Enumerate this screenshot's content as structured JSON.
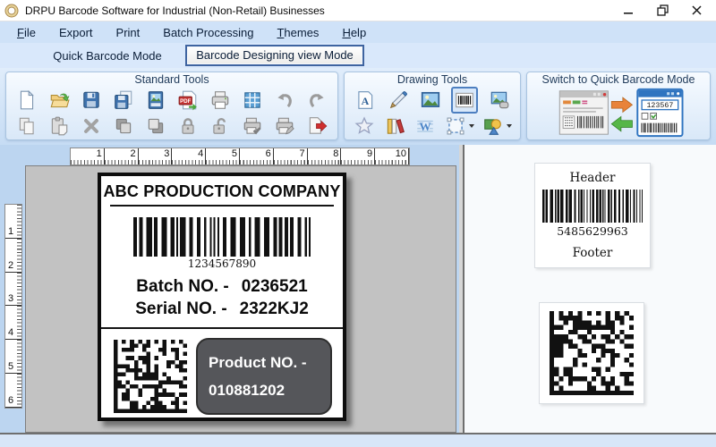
{
  "window": {
    "title": "DRPU Barcode Software for Industrial (Non-Retail) Businesses",
    "controls": [
      "minimize",
      "restore",
      "close"
    ]
  },
  "menu": {
    "items": [
      {
        "label": "File",
        "underline": 0
      },
      {
        "label": "Export",
        "underline": -1
      },
      {
        "label": "Print",
        "underline": -1
      },
      {
        "label": "Batch Processing",
        "underline": -1
      },
      {
        "label": "Themes",
        "underline": 0
      },
      {
        "label": "Help",
        "underline": 0
      }
    ]
  },
  "mode_tabs": {
    "quick": "Quick Barcode Mode",
    "designing": "Barcode Designing view Mode"
  },
  "toolbar": {
    "switch_value": "123567",
    "groups": [
      {
        "label": "Standard Tools",
        "icons_row1": [
          "new-document",
          "open-file",
          "save",
          "save-as",
          "export-image",
          "export-pdf",
          "print",
          "show-grid",
          "undo",
          "redo"
        ],
        "icons_row2": [
          "copy",
          "paste",
          "delete",
          "bring-to-front",
          "send-to-back",
          "lock",
          "unlock",
          "print-preview",
          "page-setup",
          "exit"
        ]
      },
      {
        "label": "Drawing Tools",
        "icons_row1": [
          "text-tool",
          "pencil-tool",
          "picture-tool",
          "barcode-tool",
          "image-shape-tool"
        ],
        "icons_row2": [
          "star-shape-tool",
          "library-tool",
          "watermark-tool",
          "frame-tool",
          "shapes-tool"
        ],
        "selected_tool": "barcode-tool"
      },
      {
        "label": "Switch to Quick Barcode Mode"
      }
    ]
  },
  "rulers": {
    "horizontal": [
      "1",
      "2",
      "3",
      "4",
      "5",
      "6",
      "7",
      "8",
      "9",
      "10"
    ],
    "vertical": [
      "1",
      "2",
      "3",
      "4",
      "5",
      "6"
    ]
  },
  "design_label": {
    "company": "ABC PRODUCTION COMPANY",
    "barcode_text": "1234567890",
    "batch_label": "Batch NO. -",
    "batch_value": "0236521",
    "serial_label": "Serial NO. -",
    "serial_value": "2322KJ2",
    "product_line1": "Product NO. -",
    "product_line2": "010881202"
  },
  "preview_panel": {
    "header": "Header",
    "barcode_text": "5485629963",
    "footer": "Footer"
  },
  "colors": {
    "accent_blue": "#3e72ad",
    "selection_border": "#4d7fc0",
    "canvas_gray": "#c2c2c2",
    "product_box_gray": "#55565a",
    "toolbar_blue": "#d3e3f6"
  }
}
